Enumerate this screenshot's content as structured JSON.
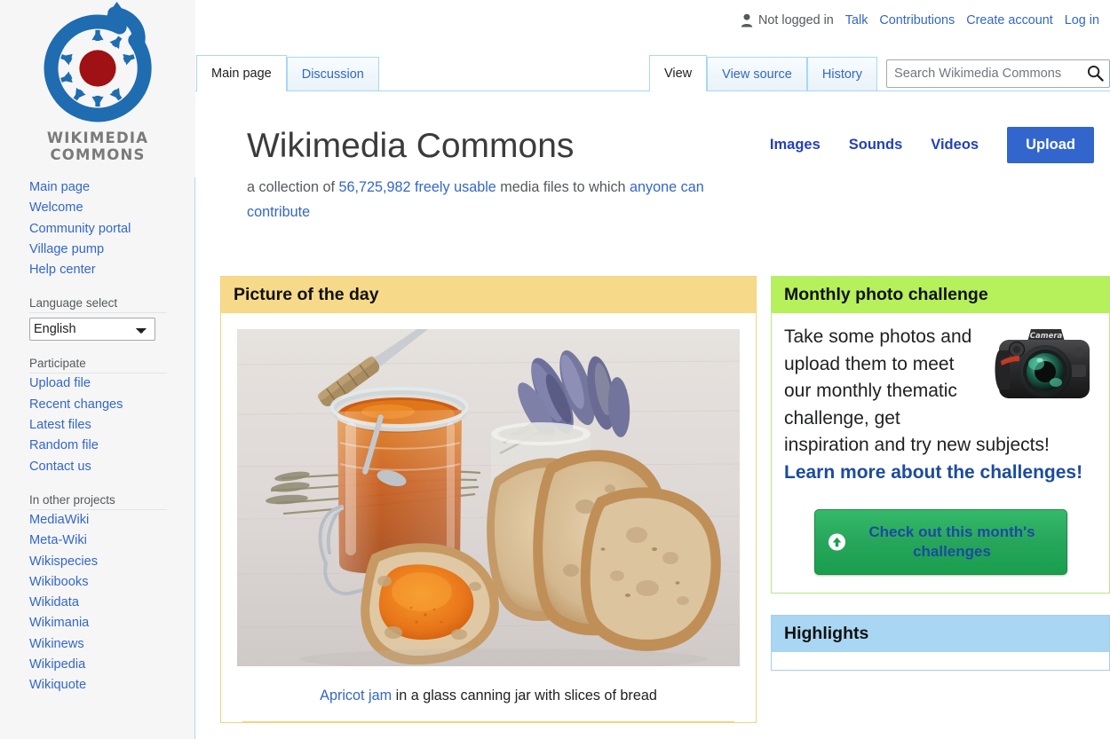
{
  "personal_bar": {
    "user_status": "Not logged in",
    "user_icon": "person-icon",
    "links": [
      "Talk",
      "Contributions",
      "Create account",
      "Log in"
    ]
  },
  "tabs": {
    "namespace": [
      {
        "label": "Main page",
        "selected": true
      },
      {
        "label": "Discussion",
        "selected": false
      }
    ],
    "views": [
      {
        "label": "View",
        "selected": true
      },
      {
        "label": "View source",
        "selected": false
      },
      {
        "label": "History",
        "selected": false
      }
    ]
  },
  "search": {
    "placeholder": "Search Wikimedia Commons",
    "value": "",
    "icon": "search-icon"
  },
  "sidebar": {
    "logo_line1": "WIKIMEDIA",
    "logo_line2": "COMMONS",
    "navigation": [
      {
        "label": "Main page"
      },
      {
        "label": "Welcome"
      },
      {
        "label": "Community portal"
      },
      {
        "label": "Village pump"
      },
      {
        "label": "Help center"
      }
    ],
    "language_heading": "Language select",
    "language_selected": "English",
    "language_options": [
      "English"
    ],
    "participate_heading": "Participate",
    "participate": [
      {
        "label": "Upload file"
      },
      {
        "label": "Recent changes"
      },
      {
        "label": "Latest files"
      },
      {
        "label": "Random file"
      },
      {
        "label": "Contact us"
      }
    ],
    "projects_heading": "In other projects",
    "projects": [
      {
        "label": "MediaWiki"
      },
      {
        "label": "Meta-Wiki"
      },
      {
        "label": "Wikispecies"
      },
      {
        "label": "Wikibooks"
      },
      {
        "label": "Wikidata"
      },
      {
        "label": "Wikimania"
      },
      {
        "label": "Wikinews"
      },
      {
        "label": "Wikipedia"
      },
      {
        "label": "Wikiquote"
      }
    ]
  },
  "main": {
    "title": "Wikimedia Commons",
    "tagline_part1": "a collection of ",
    "tagline_count": "56,725,982",
    "tagline_freely": " freely usable",
    "tagline_part2": " media files to which ",
    "tagline_anyone": "anyone can contribute",
    "media_links": [
      "Images",
      "Sounds",
      "Videos"
    ],
    "upload_label": "Upload"
  },
  "picture_of_the_day": {
    "heading": "Picture of the day",
    "image_alt": "Apricot jam in a glass canning jar with slices of bread",
    "caption_link": "Apricot jam",
    "caption_rest": " in a glass canning jar with slices of bread"
  },
  "monthly_challenge": {
    "heading": "Monthly photo challenge",
    "body_text": "Take some photos and upload them to meet our monthly thematic challenge, get inspiration and try new subjects! ",
    "body_link": "Learn more about the challenges!",
    "camera_label": "Camera",
    "cta_label": "Check out this month's challenges",
    "cta_icon": "upload-arrow-icon"
  },
  "highlights": {
    "heading": "Highlights"
  },
  "colors": {
    "link": "#3366cc",
    "potd_header": "#f7da89",
    "potd_border": "#f2d37e",
    "challenge_header": "#b6f05a",
    "challenge_border": "#b8e986",
    "highlights_header": "#a9d6f2",
    "highlights_border": "#a6cfe9",
    "upload_button": "#3366cc",
    "cta_green": "#27a65b",
    "logo_blue": "#1f6cb0",
    "logo_red": "#9f1114",
    "sidebar_bg": "#f6f6f6",
    "tab_border": "#a7d7f9"
  }
}
